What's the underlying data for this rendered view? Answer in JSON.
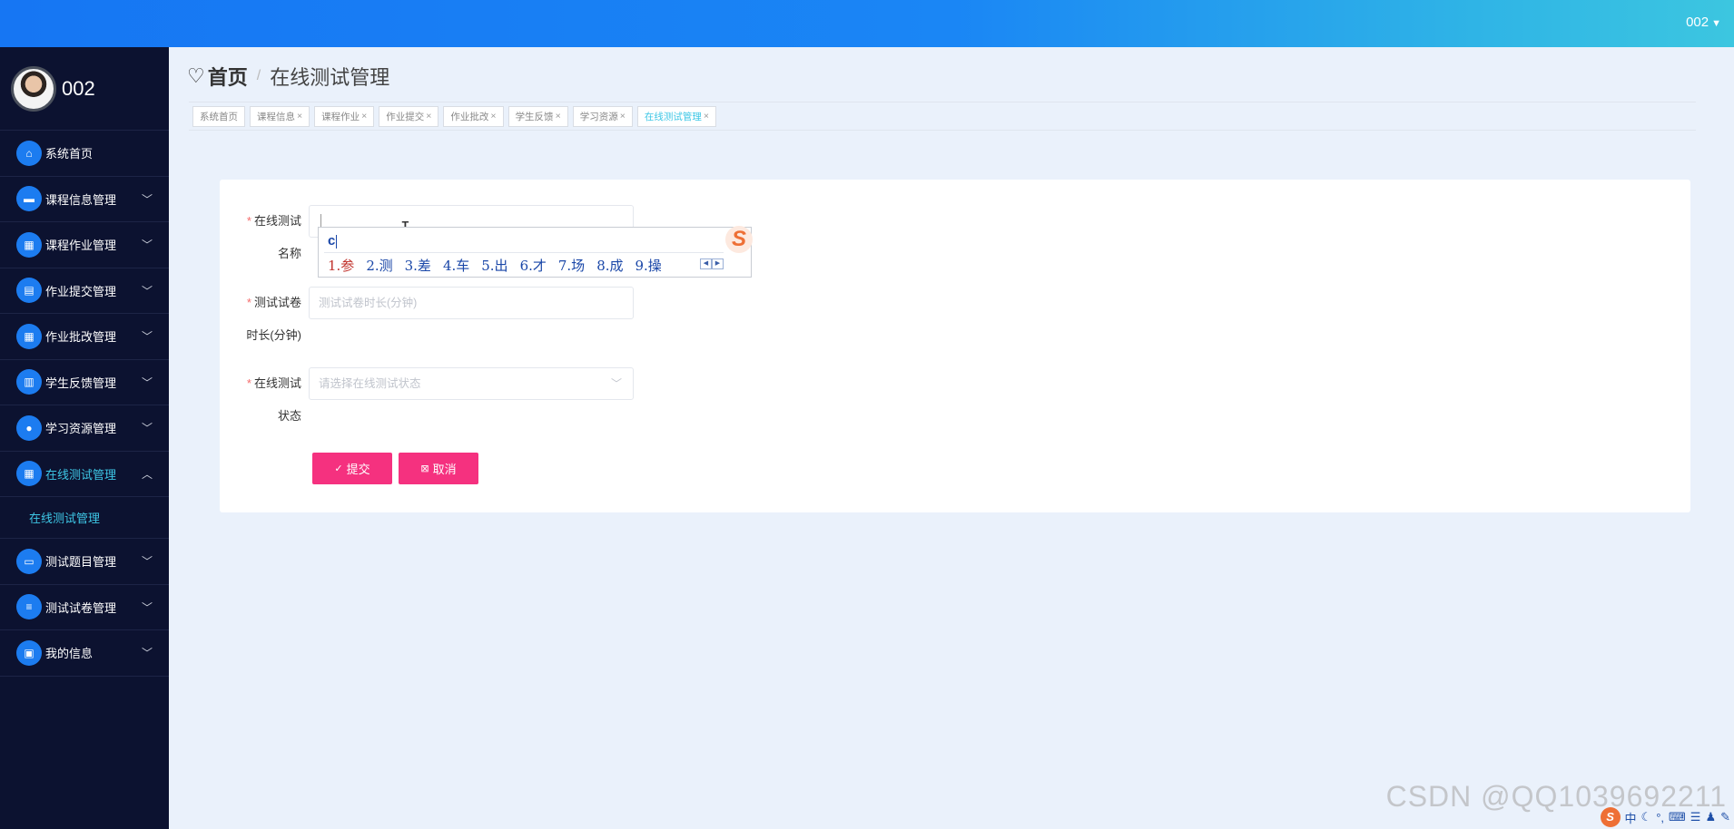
{
  "header": {
    "username": "002"
  },
  "sidebar": {
    "profile_name": "002",
    "items": [
      {
        "label": "系统首页"
      },
      {
        "label": "课程信息管理"
      },
      {
        "label": "课程作业管理"
      },
      {
        "label": "作业提交管理"
      },
      {
        "label": "作业批改管理"
      },
      {
        "label": "学生反馈管理"
      },
      {
        "label": "学习资源管理"
      },
      {
        "label": "在线测试管理"
      },
      {
        "label": "测试题目管理"
      },
      {
        "label": "测试试卷管理"
      },
      {
        "label": "我的信息"
      }
    ],
    "submenu_label": "在线测试管理"
  },
  "breadcrumb": {
    "home": "首页",
    "current": "在线测试管理"
  },
  "tags": [
    "系统首页",
    "课程信息",
    "课程作业",
    "作业提交",
    "作业批改",
    "学生反馈",
    "学习资源",
    "在线测试管理"
  ],
  "form": {
    "field1": {
      "label_line1": "在线测试",
      "label_line2": "名称",
      "value": ""
    },
    "field2": {
      "label_line1": "测试试卷",
      "label_line2": "时长(分钟)",
      "placeholder": "测试试卷时长(分钟)"
    },
    "field3": {
      "label_line1": "在线测试",
      "label_line2": "状态",
      "placeholder": "请选择在线测试状态"
    },
    "submit_label": "提交",
    "cancel_label": "取消"
  },
  "ime": {
    "typed": "c",
    "candidates": [
      "1.参",
      "2.测",
      "3.差",
      "4.车",
      "5.出",
      "6.才",
      "7.场",
      "8.成",
      "9.操"
    ]
  },
  "watermark": "CSDN @QQ1039692211",
  "tray": {
    "lang": "中"
  }
}
